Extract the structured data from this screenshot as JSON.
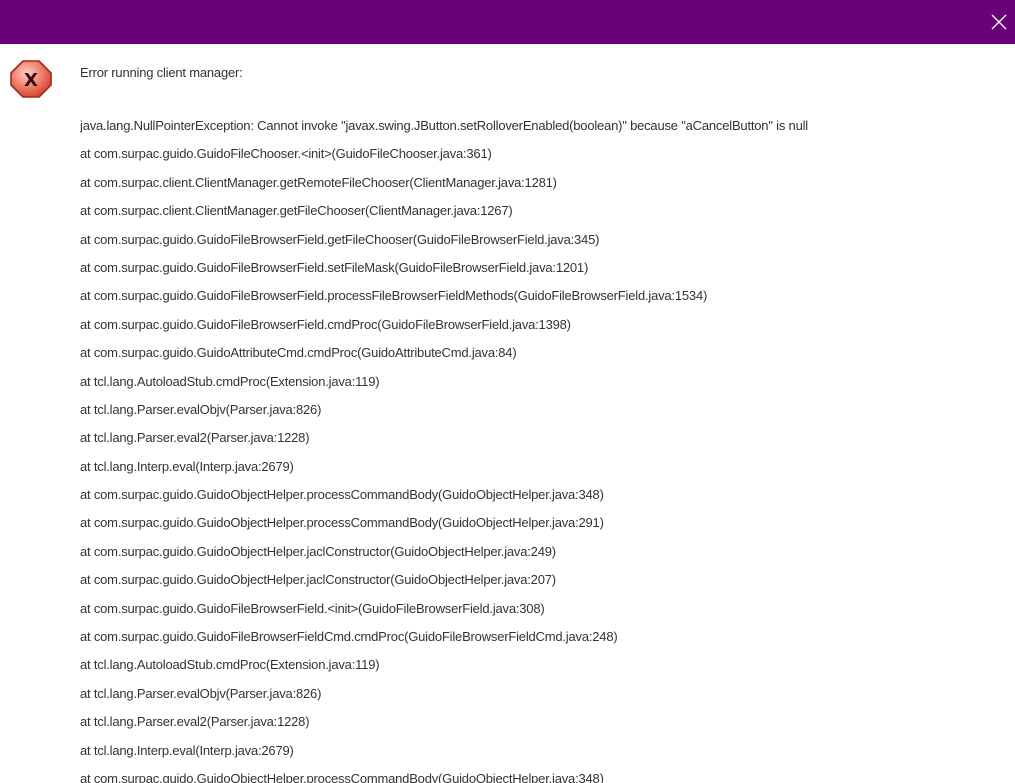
{
  "dialog": {
    "title_bar_color": "#6b007b",
    "close_icon": "close-icon",
    "error_icon": "error-x-icon",
    "heading": "Error running client manager:",
    "trace": [
      "java.lang.NullPointerException: Cannot invoke \"javax.swing.JButton.setRolloverEnabled(boolean)\" because \"aCancelButton\" is null",
      "at com.surpac.guido.GuidoFileChooser.<init>(GuidoFileChooser.java:361)",
      "at com.surpac.client.ClientManager.getRemoteFileChooser(ClientManager.java:1281)",
      "at com.surpac.client.ClientManager.getFileChooser(ClientManager.java:1267)",
      "at com.surpac.guido.GuidoFileBrowserField.getFileChooser(GuidoFileBrowserField.java:345)",
      "at com.surpac.guido.GuidoFileBrowserField.setFileMask(GuidoFileBrowserField.java:1201)",
      "at com.surpac.guido.GuidoFileBrowserField.processFileBrowserFieldMethods(GuidoFileBrowserField.java:1534)",
      "at com.surpac.guido.GuidoFileBrowserField.cmdProc(GuidoFileBrowserField.java:1398)",
      "at com.surpac.guido.GuidoAttributeCmd.cmdProc(GuidoAttributeCmd.java:84)",
      "at tcl.lang.AutoloadStub.cmdProc(Extension.java:119)",
      "at tcl.lang.Parser.evalObjv(Parser.java:826)",
      "at tcl.lang.Parser.eval2(Parser.java:1228)",
      "at tcl.lang.Interp.eval(Interp.java:2679)",
      "at com.surpac.guido.GuidoObjectHelper.processCommandBody(GuidoObjectHelper.java:348)",
      "at com.surpac.guido.GuidoObjectHelper.processCommandBody(GuidoObjectHelper.java:291)",
      "at com.surpac.guido.GuidoObjectHelper.jaclConstructor(GuidoObjectHelper.java:249)",
      "at com.surpac.guido.GuidoObjectHelper.jaclConstructor(GuidoObjectHelper.java:207)",
      "at com.surpac.guido.GuidoFileBrowserField.<init>(GuidoFileBrowserField.java:308)",
      "at com.surpac.guido.GuidoFileBrowserFieldCmd.cmdProc(GuidoFileBrowserFieldCmd.java:248)",
      "at tcl.lang.AutoloadStub.cmdProc(Extension.java:119)",
      "at tcl.lang.Parser.evalObjv(Parser.java:826)",
      "at tcl.lang.Parser.eval2(Parser.java:1228)",
      "at tcl.lang.Interp.eval(Interp.java:2679)",
      "at com.surpac.guido.GuidoObjectHelper.processCommandBody(GuidoObjectHelper.java:348)"
    ]
  }
}
